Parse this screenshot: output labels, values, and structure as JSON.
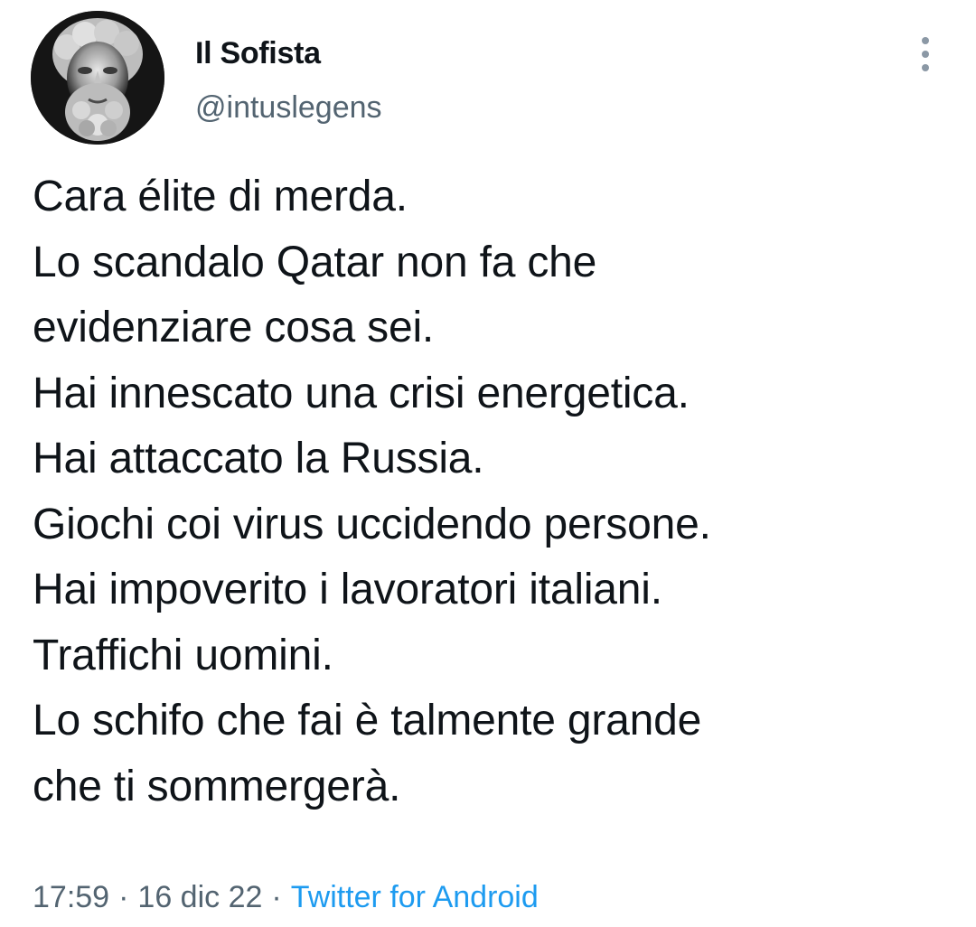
{
  "author": {
    "name": "Il Sofista",
    "handle": "@intuslegens"
  },
  "tweet": {
    "lines": [
      "Cara élite di merda.",
      "Lo scandalo Qatar non fa che",
      "evidenziare cosa sei.",
      "Hai innescato una crisi energetica.",
      "Hai attaccato la Russia.",
      "Giochi coi virus uccidendo persone.",
      "Hai impoverito i lavoratori italiani.",
      "Traffichi uomini.",
      "Lo schifo che fai è talmente grande",
      "che ti sommergerà."
    ]
  },
  "meta": {
    "time": "17:59",
    "separator": "·",
    "date": "16 dic 22",
    "source": "Twitter for Android"
  },
  "icons": {
    "more": "more-vertical-icon"
  },
  "colors": {
    "text": "#0f1419",
    "secondary": "#536471",
    "link": "#1d9bf0"
  }
}
